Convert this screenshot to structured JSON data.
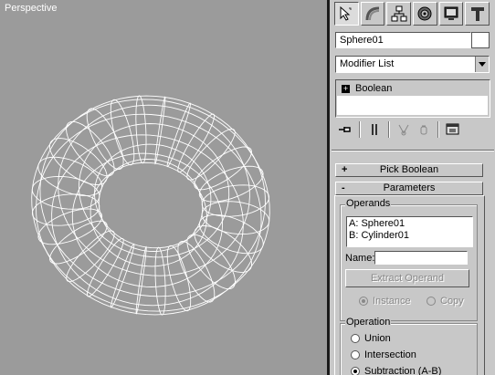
{
  "viewport": {
    "label": "Perspective"
  },
  "command_panel": {
    "tabs": [
      "create-icon",
      "modify-icon",
      "hierarchy-icon",
      "motion-icon",
      "display-icon",
      "utilities-icon"
    ],
    "active_tab": "create-icon",
    "object_name": "Sphere01",
    "modifier_list": "Modifier List",
    "stack": {
      "item": "Boolean"
    },
    "rollouts": {
      "pick_boolean": {
        "sign": "+",
        "label": "Pick Boolean"
      },
      "parameters": {
        "sign": "-",
        "label": "Parameters"
      }
    },
    "operands": {
      "title": "Operands",
      "items": [
        "A: Sphere01",
        "B: Cylinder01"
      ],
      "name_label": "Name:",
      "name_value": "",
      "extract_button": "Extract Operand",
      "instance_label": "Instance",
      "copy_label": "Copy"
    },
    "operation": {
      "title": "Operation",
      "union": "Union",
      "intersection": "Intersection",
      "subtraction": "Subtraction (A-B)",
      "selected": "Subtraction (A-B)"
    }
  }
}
